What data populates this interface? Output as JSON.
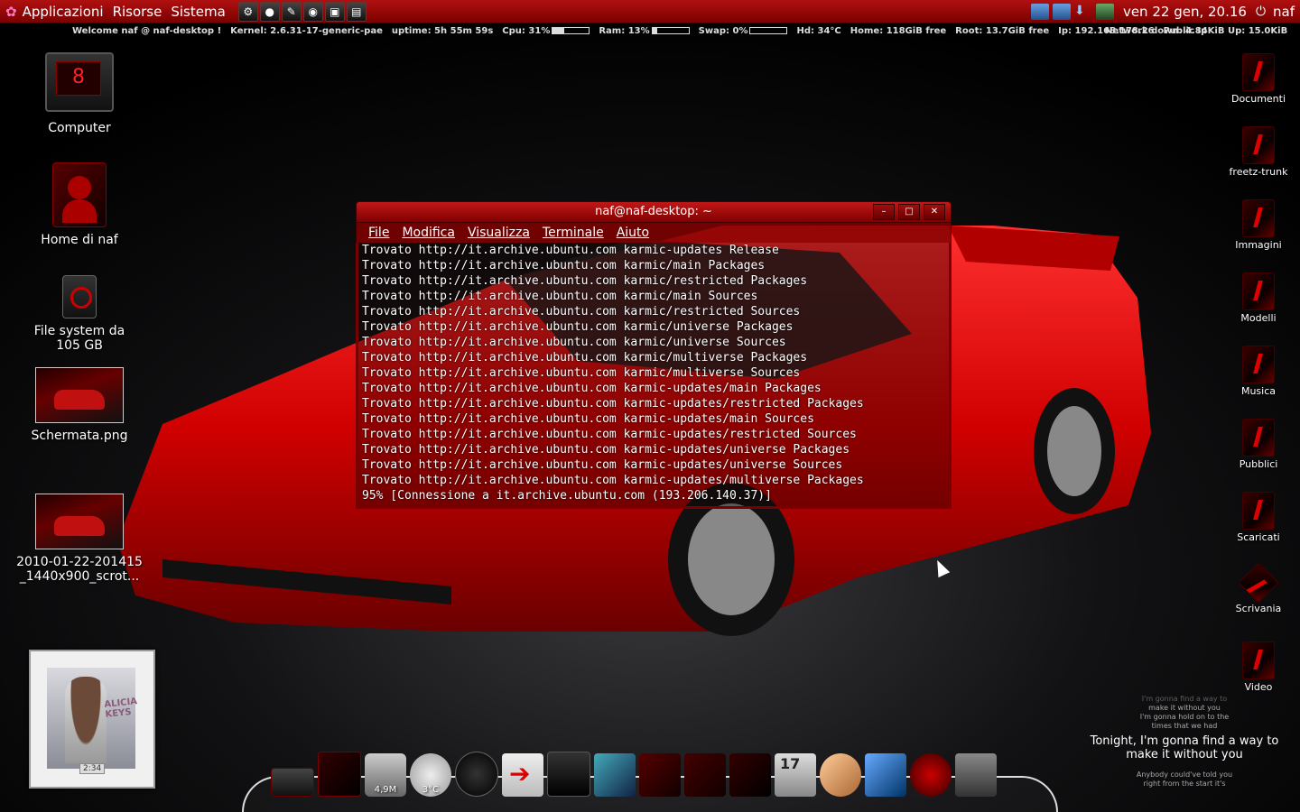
{
  "top_panel": {
    "menus": [
      "Applicazioni",
      "Risorse",
      "Sistema"
    ],
    "clock": "ven 22 gen, 20.16",
    "user": "naf"
  },
  "conky": {
    "welcome": "Welcome naf @ naf-desktop !",
    "kernel_label": "Kernel:",
    "kernel": "2.6.31-17-generic-pae",
    "uptime_label": "uptime:",
    "uptime": "5h 55m 59s",
    "cpu_label": "Cpu:",
    "cpu": "31%",
    "cpu_level": 0.31,
    "ram_label": "Ram:",
    "ram": "13%",
    "ram_level": 0.13,
    "swap_label": "Swap:",
    "swap": "0%",
    "swap_level": 0.0,
    "hd_label": "Hd:",
    "hd": "34°C",
    "home_label": "Home:",
    "home": "118GiB",
    "free1": "free",
    "root_label": "Root:",
    "root": "13.7GiB",
    "free2": "free",
    "ip_label": "Ip:",
    "ip": "192.168.178.26",
    "public_ip": "Public Ip",
    "net_down_label": "Network down:",
    "net_down": "4.84KiB",
    "net_up_label": "Up:",
    "net_up": "15.0KiB"
  },
  "desktop_left": [
    {
      "label": "Computer"
    },
    {
      "label": "Home di naf"
    },
    {
      "label": "File system da 105 GB"
    },
    {
      "label": "Schermata.png"
    },
    {
      "label": "2010-01-22-201415_1440x900_scrot..."
    }
  ],
  "desktop_right": [
    {
      "label": "Documenti"
    },
    {
      "label": "freetz-trunk"
    },
    {
      "label": "Immagini"
    },
    {
      "label": "Modelli"
    },
    {
      "label": "Musica"
    },
    {
      "label": "Pubblici"
    },
    {
      "label": "Scaricati"
    },
    {
      "label": "Scrivania"
    },
    {
      "label": "Video"
    }
  ],
  "terminal": {
    "title": "naf@naf-desktop: ~",
    "menus": [
      "File",
      "Modifica",
      "Visualizza",
      "Terminale",
      "Aiuto"
    ],
    "lines": [
      "Trovato http://it.archive.ubuntu.com karmic-updates Release",
      "Trovato http://it.archive.ubuntu.com karmic/main Packages",
      "Trovato http://it.archive.ubuntu.com karmic/restricted Packages",
      "Trovato http://it.archive.ubuntu.com karmic/main Sources",
      "Trovato http://it.archive.ubuntu.com karmic/restricted Sources",
      "Trovato http://it.archive.ubuntu.com karmic/universe Packages",
      "Trovato http://it.archive.ubuntu.com karmic/universe Sources",
      "Trovato http://it.archive.ubuntu.com karmic/multiverse Packages",
      "Trovato http://it.archive.ubuntu.com karmic/multiverse Sources",
      "Trovato http://it.archive.ubuntu.com karmic-updates/main Packages",
      "Trovato http://it.archive.ubuntu.com karmic-updates/restricted Packages",
      "Trovato http://it.archive.ubuntu.com karmic-updates/main Sources",
      "Trovato http://it.archive.ubuntu.com karmic-updates/restricted Sources",
      "Trovato http://it.archive.ubuntu.com karmic-updates/universe Packages",
      "Trovato http://it.archive.ubuntu.com karmic-updates/universe Sources",
      "Trovato http://it.archive.ubuntu.com karmic-updates/multiverse Packages",
      "95% [Connessione a it.archive.ubuntu.com (193.206.140.37)]"
    ]
  },
  "album": {
    "artist": "ALICIA KEYS",
    "time": "2:34"
  },
  "lyrics": {
    "prev1": "I'm gonna find a way to",
    "prev2": "make it without you",
    "prev3": "I'm gonna hold on to the",
    "prev4": "times that we had",
    "current": "Tonight, I'm gonna find a way to make it without you",
    "next1": "Anybody could've told you",
    "next2": "right from the start it's"
  },
  "dock": {
    "trash_size": "4,9M",
    "weather_temp": "3°C",
    "calendar_day": "17"
  },
  "colors": {
    "panel_red": "#b01010",
    "accent_red": "#d00000"
  }
}
